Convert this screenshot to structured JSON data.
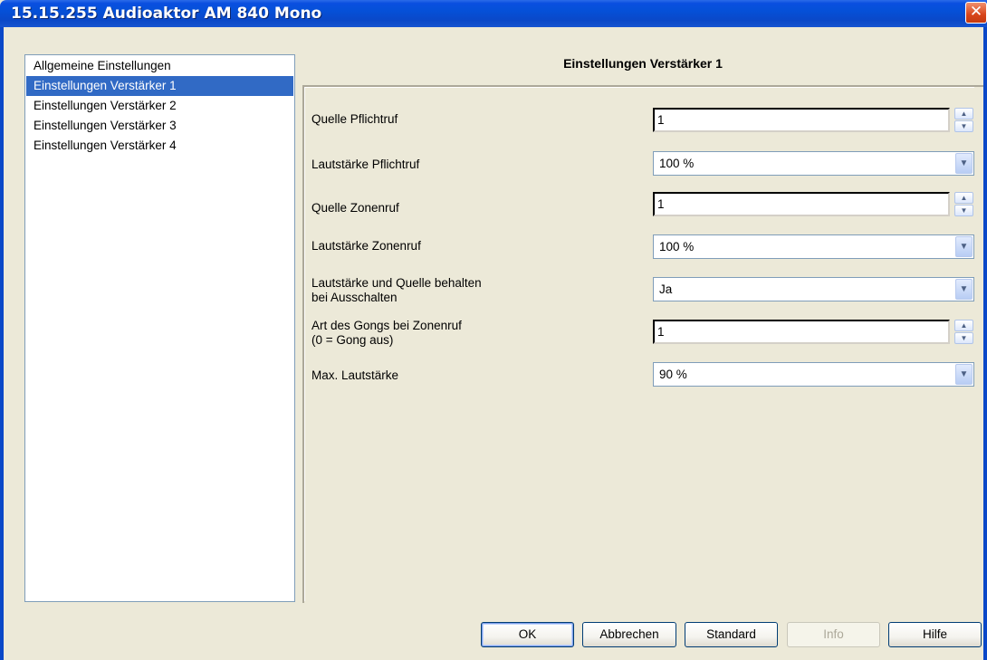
{
  "window": {
    "title": "15.15.255 Audioaktor AM 840 Mono",
    "close_glyph": "✕"
  },
  "nav": {
    "items": [
      {
        "label": "Allgemeine Einstellungen",
        "selected": false
      },
      {
        "label": "Einstellungen Verstärker 1",
        "selected": true
      },
      {
        "label": "Einstellungen Verstärker 2",
        "selected": false
      },
      {
        "label": "Einstellungen Verstärker 3",
        "selected": false
      },
      {
        "label": "Einstellungen Verstärker 4",
        "selected": false
      }
    ]
  },
  "panel": {
    "header": "Einstellungen Verstärker 1",
    "params": [
      {
        "label": "Quelle Pflichtruf",
        "value": "1",
        "control": "spinner"
      },
      {
        "label": "Lautstärke Pflichtruf",
        "value": "100 %",
        "control": "dropdown"
      },
      {
        "label": "Quelle Zonenruf",
        "value": "1",
        "control": "spinner"
      },
      {
        "label": "Lautstärke Zonenruf",
        "value": "100 %",
        "control": "dropdown"
      },
      {
        "label_line1": "Lautstärke und Quelle behalten",
        "label_line2": "bei Ausschalten",
        "value": "Ja",
        "control": "dropdown"
      },
      {
        "label_line1": "Art des Gongs bei Zonenruf",
        "label_line2": "(0 = Gong aus)",
        "value": "1",
        "control": "spinner"
      },
      {
        "label": "Max. Lautstärke",
        "value": "90 %",
        "control": "dropdown"
      }
    ]
  },
  "icons": {
    "spin_up": "▲",
    "spin_down": "▼",
    "dropdown_arrow": "▼"
  },
  "buttons": {
    "ok": "OK",
    "cancel": "Abbrechen",
    "standard": "Standard",
    "info": "Info",
    "help": "Hilfe"
  },
  "colors": {
    "titlebar": "#0a4fe0",
    "selection": "#316ac5",
    "dialog_bg": "#ece9d8"
  }
}
